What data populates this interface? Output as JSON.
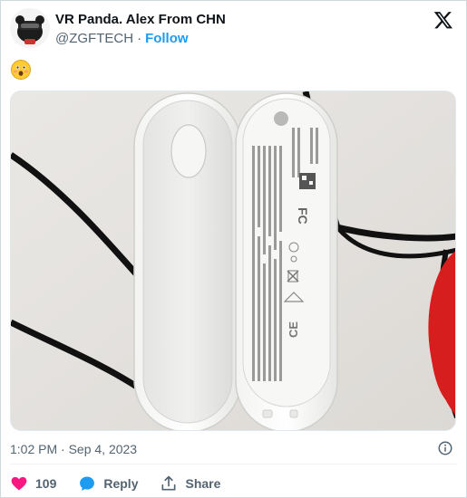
{
  "tweet": {
    "author_name": "VR Panda. Alex From CHN",
    "handle": "@ZGFTECH",
    "separator": "·",
    "follow_label": "Follow",
    "body_emoji": "😮",
    "timestamp": "1:02 PM · Sep 4, 2023"
  },
  "actions": {
    "likes": "109",
    "reply_label": "Reply",
    "share_label": "Share"
  },
  "colors": {
    "accent": "#1d9bf0",
    "like": "#f91880",
    "secondary_text": "#536471"
  },
  "icons": [
    "x-logo-icon",
    "info-icon",
    "heart-icon",
    "reply-icon",
    "share-icon"
  ],
  "media": {
    "alt_text_visible": false
  }
}
